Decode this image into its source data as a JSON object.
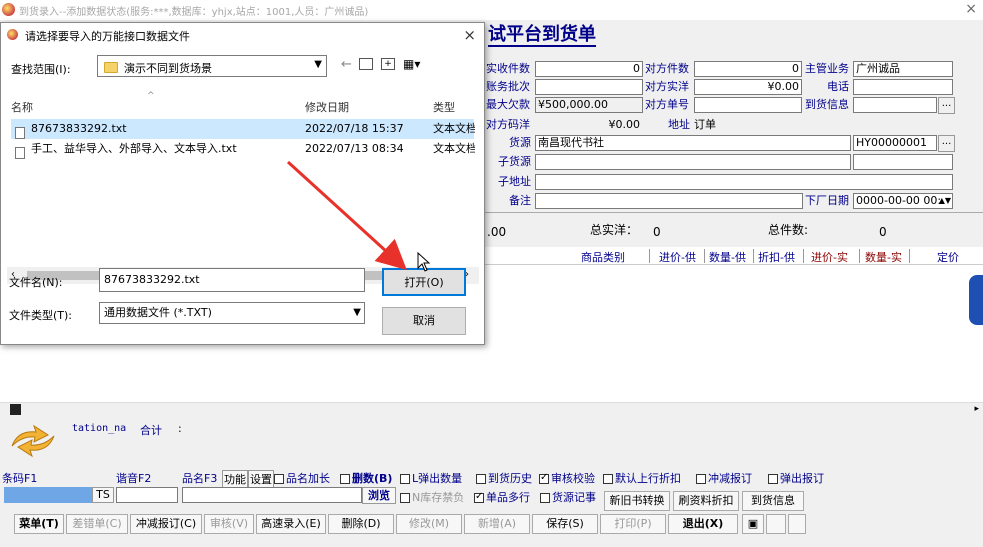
{
  "window": {
    "title": "到货录入--添加数据状态(服务:***,数据库：yhjx,站点：1001,人员：广州诚品)",
    "close": "×"
  },
  "form": {
    "heading": "试平台到货单",
    "fields": {
      "actual_count_label": "实收件数",
      "actual_count_value": "0",
      "peer_count_label": "对方件数",
      "peer_count_value": "0",
      "manager_label": "主管业务",
      "manager_value": "广州诚品",
      "batch_label": "账务批次",
      "peer_actual_label": "对方实洋",
      "peer_actual_value": "¥0.00",
      "phone_label": "电话",
      "max_owe_label": "最大欠款",
      "max_owe_value": "¥500,000.00",
      "peer_order_label": "对方单号",
      "arrival_info_label": "到货信息",
      "peer_code_label": "对方码洋",
      "peer_code_value": "¥0.00",
      "address_label": "地址",
      "address_value": "订单",
      "source_label": "货源",
      "source_value": "南昌现代书社",
      "source_code": "HY00000001",
      "sub_source_label": "子货源",
      "sub_address_label": "子地址",
      "note_label": "备注",
      "factory_date_label": "下厂日期",
      "factory_date_value": "0000-00-00 00:"
    },
    "summary": {
      "left_value": ".00",
      "total_actual_label": "总实洋：",
      "total_actual_value": "0",
      "total_count_label": "总件数:",
      "total_count_value": "0"
    },
    "grid_columns": [
      "商品类别",
      "进价-供",
      "数量-供",
      "折扣-供",
      "进价-实",
      "数量-实",
      "定价"
    ]
  },
  "dialog": {
    "title": "请选择要导入的万能接口数据文件",
    "close": "×",
    "lookin_label": "查找范围(I):",
    "lookin_value": "演示不同到货场景",
    "col_name": "名称",
    "col_date": "修改日期",
    "col_type": "类型",
    "files": [
      {
        "name": "87673833292.txt",
        "date": "2022/07/18 15:37",
        "type": "文本文档"
      },
      {
        "name": "手工、益华导入、外部导入、文本导入.txt",
        "date": "2022/07/13 08:34",
        "type": "文本文档"
      }
    ],
    "filename_label": "文件名(N):",
    "filename_value": "87673833292.txt",
    "filetype_label": "文件类型(T):",
    "filetype_value": "通用数据文件 (*.TXT)",
    "open_button": "打开(O)",
    "cancel_button": "取消"
  },
  "info": {
    "station_label": "tation_na",
    "total_label": "合计",
    "colon": ":"
  },
  "options": {
    "barcode": "条码F1",
    "voice": "谐音F2",
    "name": "品名F3",
    "function": "功能",
    "settings": "设置",
    "name_lengthen": "品名加长",
    "delete_count": "删数(B)",
    "l_popup": "L弹出数量",
    "arrival_history": "到货历史",
    "audit_verify": "审核校验",
    "default_discount": "默认上行折扣",
    "offset_report": "冲减报订",
    "popup_report": "弹出报订",
    "ts": "TS",
    "browse": "浏览",
    "n_stock": "N库存禁负",
    "multi_line": "单品多行",
    "source_note": "货源记事",
    "old_new_convert": "新旧书转换",
    "refresh_discount": "刷资料折扣",
    "arrival_info": "到货信息"
  },
  "toolbar": {
    "menu": "菜单(T)",
    "wrong": "差错单(C)",
    "offset": "冲减报订(C)",
    "audit": "审核(V)",
    "quick_entry": "高速录入(E)",
    "delete": "删除(D)",
    "modify": "修改(M)",
    "add": "新增(A)",
    "save": "保存(S)",
    "print": "打印(P)",
    "exit": "退出(X)"
  },
  "colors": {
    "heading": "#00008b",
    "selection": "#cce8ff",
    "arrow": "#e8312a",
    "accent": "#0078d7"
  }
}
